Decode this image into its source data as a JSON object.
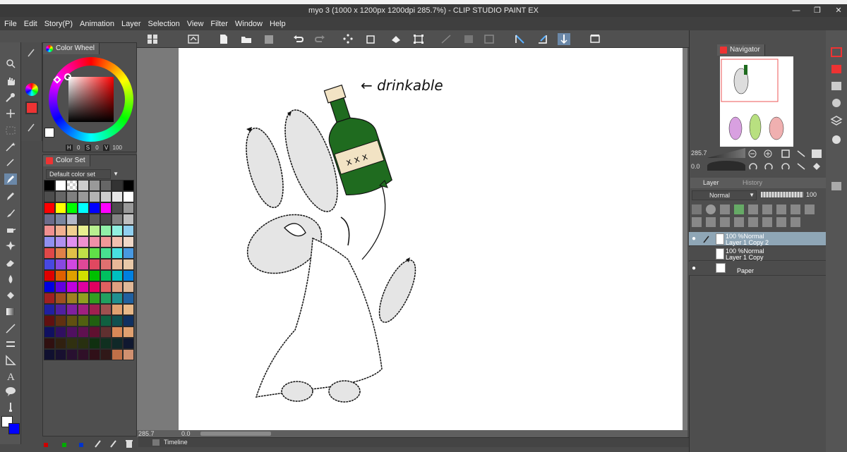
{
  "window": {
    "title": "myo 3 (1000 x 1200px 1200dpi 285.7%)  - CLIP STUDIO PAINT EX",
    "controls": [
      "—",
      "❐",
      "✕"
    ]
  },
  "menu": [
    "File",
    "Edit",
    "Story(P)",
    "Animation",
    "Layer",
    "Selection",
    "View",
    "Filter",
    "Window",
    "Help"
  ],
  "color_wheel": {
    "tab_label": "Color Wheel",
    "h_label": "H",
    "h_value": "0",
    "s_label": "S",
    "s_value": "0",
    "v_label": "V",
    "v_value": "100"
  },
  "color_set": {
    "tab_label": "Color Set",
    "dropdown": "Default color set",
    "swatches": [
      [
        "#000000",
        "#ffffff",
        "#ffffff",
        "#cccccc",
        "#999999",
        "#666666",
        "#333333",
        "#000000"
      ],
      [
        "#4d4d4d",
        "#666666",
        "#808080",
        "#999999",
        "#b3b3b3",
        "#cccccc",
        "#e6e6e6",
        "#ffffff"
      ],
      [
        "#ff0000",
        "#ffff00",
        "#00ff00",
        "#00ffff",
        "#0000ff",
        "#ff00ff",
        "#4d4d4d",
        "#999999"
      ],
      [
        "#6b6b8a",
        "#7a86a0",
        "#b3b8c8",
        "#3a3a3a",
        "#5b5b5b",
        "#4a4a4a",
        "#838383",
        "#bfbfbf"
      ],
      [
        "#f09090",
        "#f0b090",
        "#f0d090",
        "#e8f090",
        "#b8f090",
        "#90f0a8",
        "#90f0e0",
        "#90d0f0"
      ],
      [
        "#9090f0",
        "#b090f0",
        "#e090f0",
        "#f090d0",
        "#f090a8",
        "#f09898",
        "#f0c0b0",
        "#f0d8c8"
      ],
      [
        "#e04848",
        "#e08048",
        "#e0c048",
        "#c0e048",
        "#60e048",
        "#48e090",
        "#48e0e0",
        "#4898e0"
      ],
      [
        "#4848e0",
        "#8848e0",
        "#d048e0",
        "#e04898",
        "#e04860",
        "#e07070",
        "#e8b898",
        "#e8c8a8"
      ],
      [
        "#e00000",
        "#e06000",
        "#e0a000",
        "#d0e000",
        "#00c000",
        "#00c060",
        "#00c0c0",
        "#0080e0"
      ],
      [
        "#0000e0",
        "#6000e0",
        "#c000e0",
        "#e000a0",
        "#e00060",
        "#e06060",
        "#e0a080",
        "#e0b898"
      ],
      [
        "#a02020",
        "#a05020",
        "#a08020",
        "#90a020",
        "#30a020",
        "#20a060",
        "#209090",
        "#2060a0"
      ],
      [
        "#2020a0",
        "#5020a0",
        "#8020a0",
        "#a02080",
        "#a02050",
        "#a05050",
        "#e0a070",
        "#e8b888"
      ],
      [
        "#601010",
        "#603010",
        "#605010",
        "#506010",
        "#206010",
        "#106040",
        "#105050",
        "#103060"
      ],
      [
        "#101060",
        "#301060",
        "#501060",
        "#601050",
        "#601030",
        "#603030",
        "#d88858",
        "#e0a070"
      ],
      [
        "#301010",
        "#302010",
        "#303010",
        "#283010",
        "#103010",
        "#103020",
        "#102828",
        "#101830"
      ],
      [
        "#101030",
        "#181030",
        "#281030",
        "#301028",
        "#301018",
        "#301818",
        "#c07048",
        "#d09070"
      ]
    ]
  },
  "artwork": {
    "annotation": "← drinkable"
  },
  "navigator": {
    "tab_label": "Navigator",
    "zoom": "285.7",
    "angle": "0.0"
  },
  "layers": {
    "tab_label": "Layer",
    "tab2_label": "History",
    "blend_mode": "Normal",
    "opacity": "100",
    "items": [
      {
        "line1": "100 %Normal",
        "line2": "Layer 1 Copy 2"
      },
      {
        "line1": "100 %Normal",
        "line2": "Layer 1 Copy"
      },
      {
        "line1": "",
        "line2": "Paper"
      }
    ]
  },
  "status": {
    "zoom": "285.7",
    "angle": "0.0",
    "timeline_label": "Timeline"
  }
}
